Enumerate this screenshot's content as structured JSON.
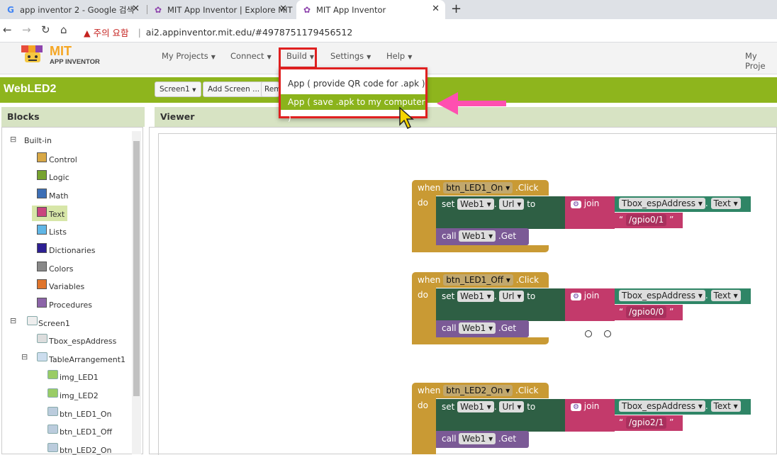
{
  "browser": {
    "tabs": [
      {
        "title": "app inventor 2 - Google 검색",
        "icon": "google-icon"
      },
      {
        "title": "MIT App Inventor | Explore MIT",
        "icon": "app-inventor-icon"
      },
      {
        "title": "MIT App Inventor",
        "icon": "app-inventor-icon"
      }
    ],
    "address": {
      "warning": "▲ 주의 요함",
      "url": "ai2.appinventor.mit.edu/#4978751179456512"
    }
  },
  "nav": {
    "logo_mit": "MIT",
    "logo_sub": "APP INVENTOR",
    "menus": [
      "My Projects",
      "Connect",
      "Build",
      "Settings",
      "Help"
    ],
    "right": "My Proje"
  },
  "build_menu": {
    "items": [
      "App ( provide QR code for .apk )",
      "App ( save .apk to my computer )"
    ],
    "highlighted_index": 1
  },
  "toolbar": {
    "project_name": "WebLED2",
    "screen_dropdown": "Screen1",
    "add_screen": "Add Screen ...",
    "remove_screen": "Rem"
  },
  "panels": {
    "blocks": "Blocks",
    "viewer": "Viewer"
  },
  "tree": {
    "builtin": "Built-in",
    "builtin_items": [
      {
        "label": "Control",
        "color": "#d8a846"
      },
      {
        "label": "Logic",
        "color": "#77a32f"
      },
      {
        "label": "Math",
        "color": "#3d6fb6"
      },
      {
        "label": "Text",
        "color": "#c9457e"
      },
      {
        "label": "Lists",
        "color": "#60b6e6"
      },
      {
        "label": "Dictionaries",
        "color": "#2d1f93"
      },
      {
        "label": "Colors",
        "color": "#888888"
      },
      {
        "label": "Variables",
        "color": "#e0752c"
      },
      {
        "label": "Procedures",
        "color": "#8c64a8"
      }
    ],
    "screen": "Screen1",
    "components": [
      "Tbox_espAddress",
      "TableArrangement1",
      "img_LED1",
      "img_LED2",
      "btn_LED1_On",
      "btn_LED1_Off",
      "btn_LED2_On"
    ]
  },
  "blocks": [
    {
      "when": "when",
      "button": "btn_LED1_On",
      "event": ".Click",
      "do": "do",
      "set": "set",
      "web": "Web1",
      "url": "Url",
      "to": "to",
      "join": "join",
      "tbox": "Tbox_espAddress",
      "text": "Text",
      "path": "/gpio0/1",
      "call": "call",
      "get": ".Get"
    },
    {
      "when": "when",
      "button": "btn_LED1_Off",
      "event": ".Click",
      "do": "do",
      "set": "set",
      "web": "Web1",
      "url": "Url",
      "to": "to",
      "join": "join",
      "tbox": "Tbox_espAddress",
      "text": "Text",
      "path": "/gpio0/0",
      "call": "call",
      "get": ".Get"
    },
    {
      "when": "when",
      "button": "btn_LED2_On",
      "event": ".Click",
      "do": "do",
      "set": "set",
      "web": "Web1",
      "url": "Url",
      "to": "to",
      "join": "join",
      "tbox": "Tbox_espAddress",
      "text": "Text",
      "path": "/gpio2/1",
      "call": "call",
      "get": ".Get"
    }
  ]
}
